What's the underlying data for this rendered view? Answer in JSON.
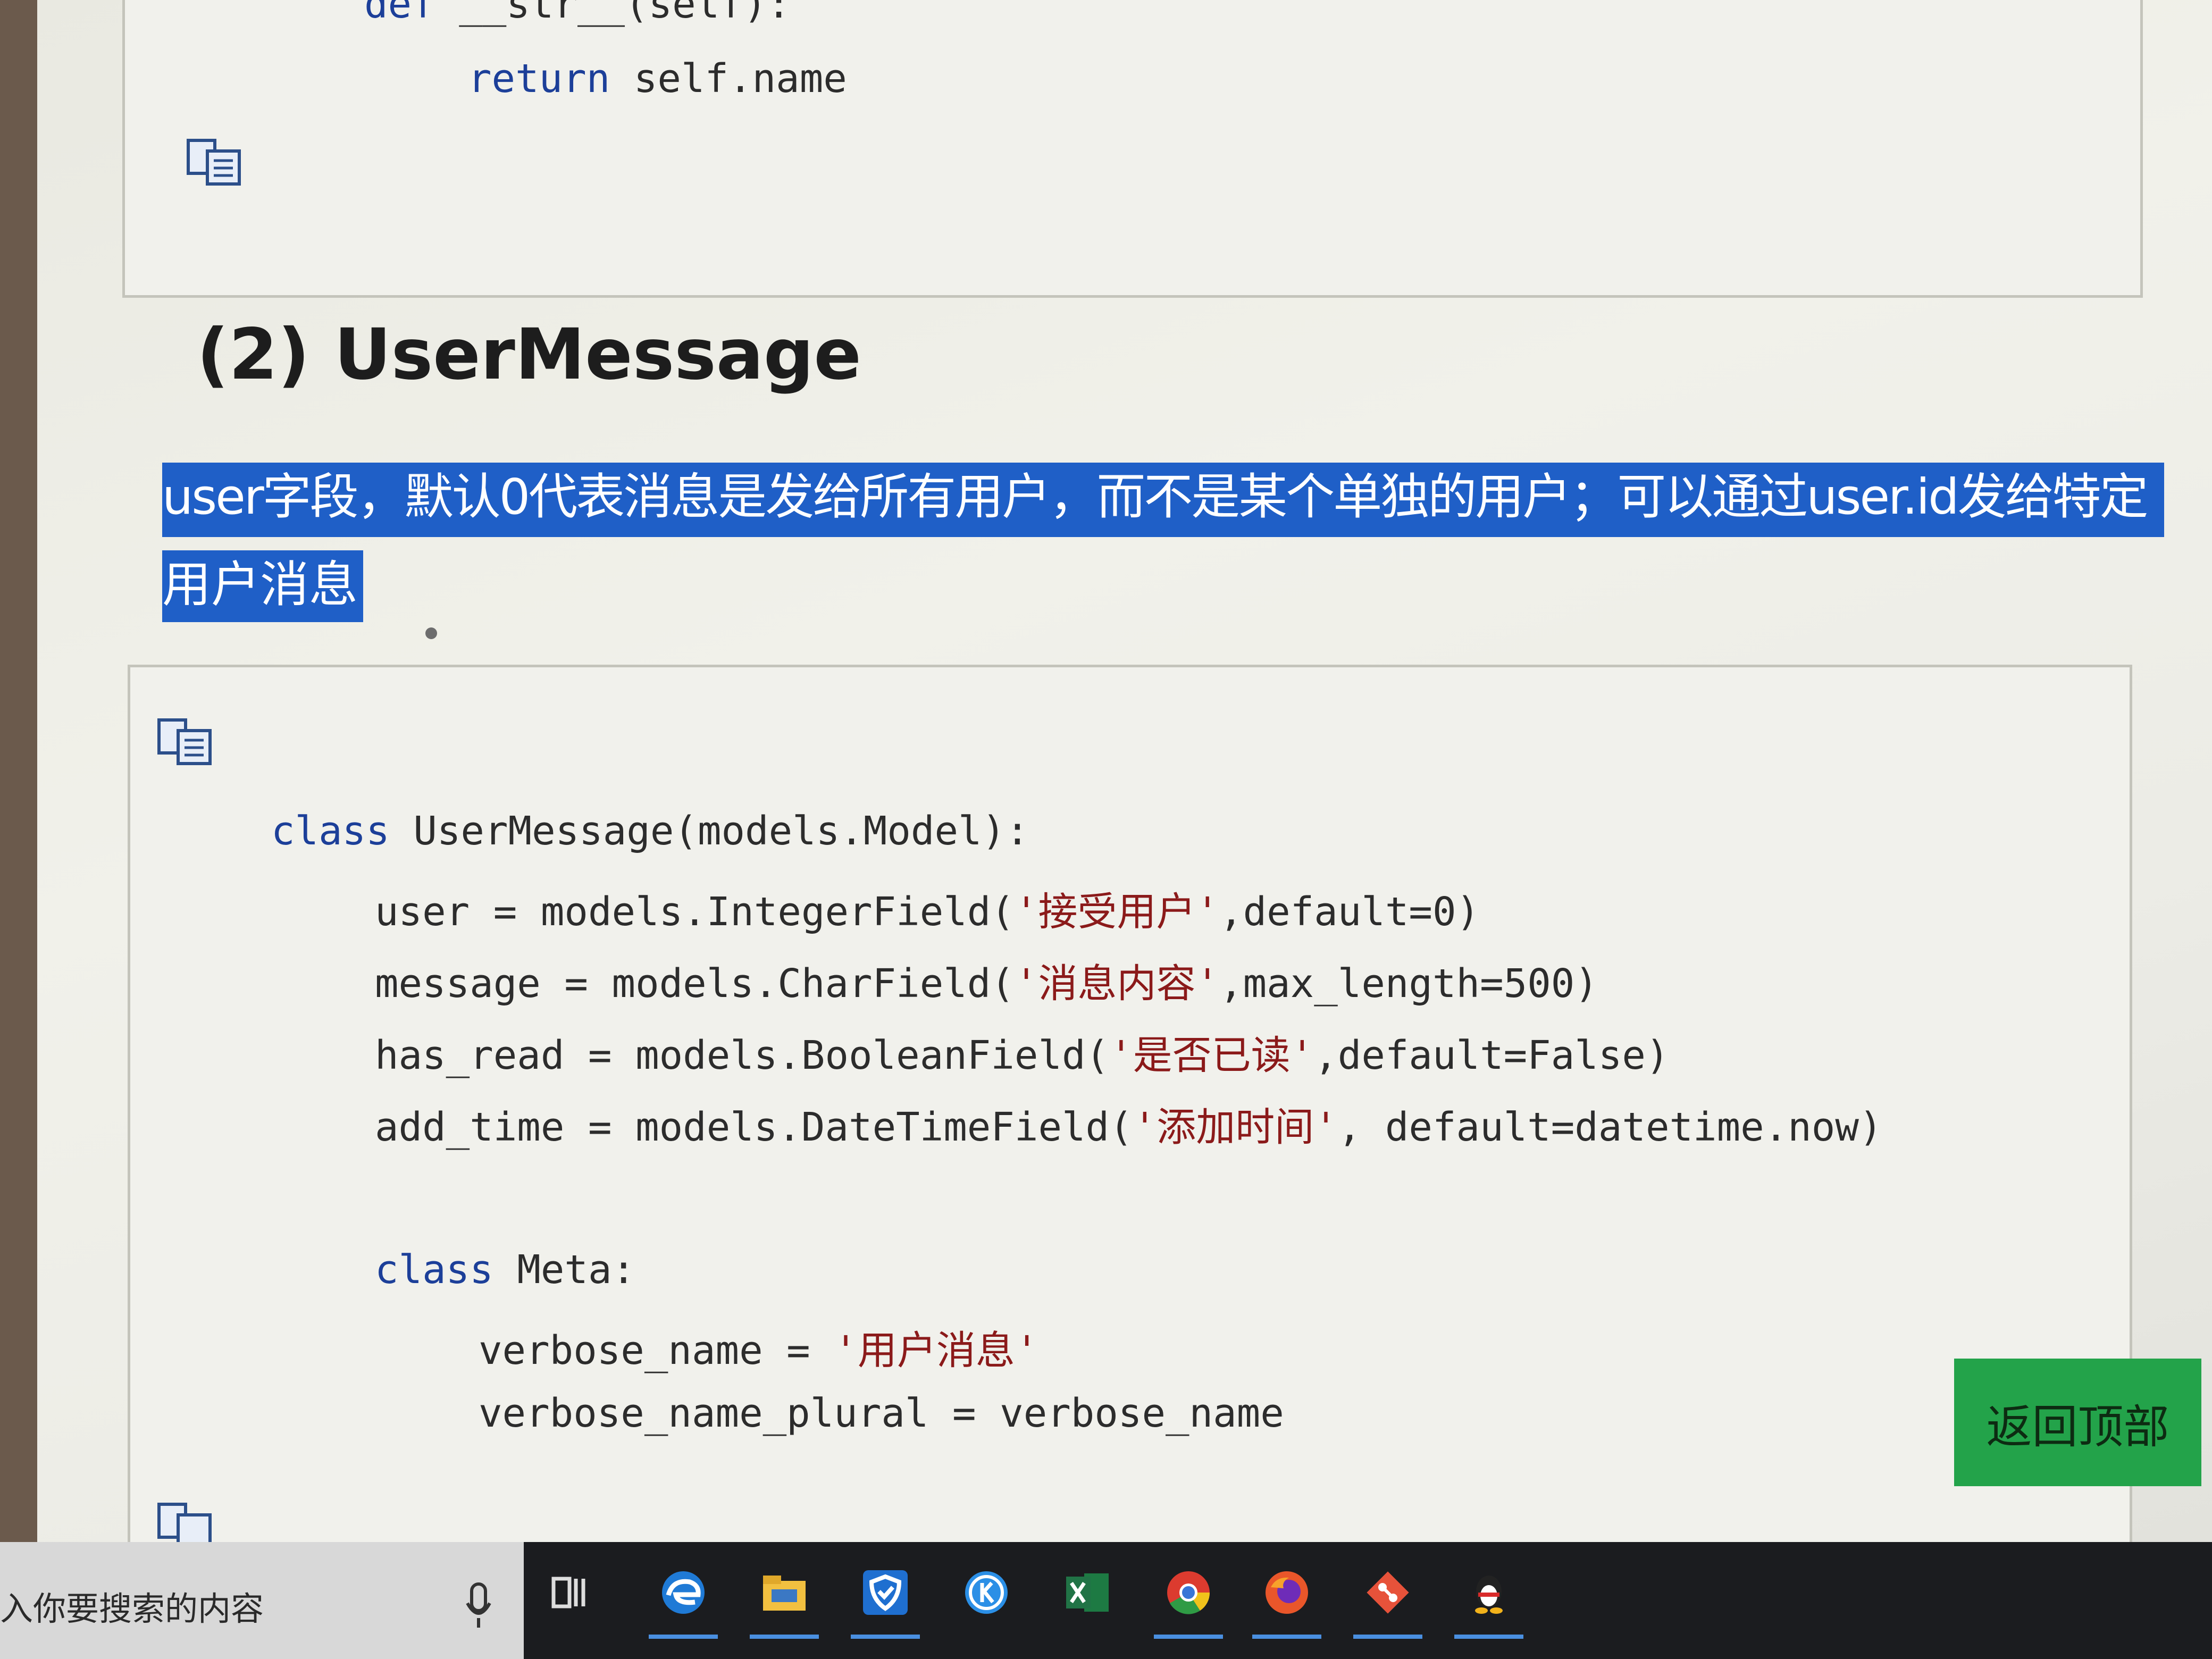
{
  "top_code": {
    "line1": {
      "kw": "def",
      "rest": " __str__(self):"
    },
    "line2": {
      "kw": "return",
      "rest": " self.name"
    }
  },
  "section": {
    "title": "(2) UserMessage"
  },
  "highlight": {
    "line1": "user字段，默认0代表消息是发给所有用户，而不是某个单独的用户；可以通过user.id发给特定",
    "line2": "用户消息"
  },
  "main_code": {
    "l1": {
      "kw": "class",
      "rest": " UserMessage(models.Model):"
    },
    "l2": {
      "pre": "user = models.IntegerField(",
      "str": "'接受用户'",
      "post": ",default=0)"
    },
    "l3": {
      "pre": "message = models.CharField(",
      "str": "'消息内容'",
      "post": ",max_length=500)"
    },
    "l4": {
      "pre": "has_read = models.BooleanField(",
      "str": "'是否已读'",
      "post": ",default=False)"
    },
    "l5": {
      "pre": "add_time = models.DateTimeField(",
      "str": "'添加时间'",
      "post": ", default=datetime.now)"
    },
    "l6": {
      "kw": "class",
      "rest": " Meta:"
    },
    "l7": {
      "pre": "verbose_name = ",
      "str": "'用户消息'"
    },
    "l8": {
      "pre": "verbose_name_plural = verbose_name"
    }
  },
  "back_to_top": {
    "label": "返回顶部"
  },
  "taskbar": {
    "search_placeholder": "入你要搜索的内容",
    "icons": [
      "task-view-icon",
      "edge-icon",
      "file-explorer-icon",
      "security-shield-icon",
      "k-app-icon",
      "excel-icon",
      "chrome-icon",
      "firefox-icon",
      "git-icon",
      "qq-icon"
    ]
  },
  "colors": {
    "highlight": "#1f5fc7",
    "back_to_top": "#23a34a",
    "keyword": "#1c3f99",
    "string": "#8b1a1a"
  }
}
